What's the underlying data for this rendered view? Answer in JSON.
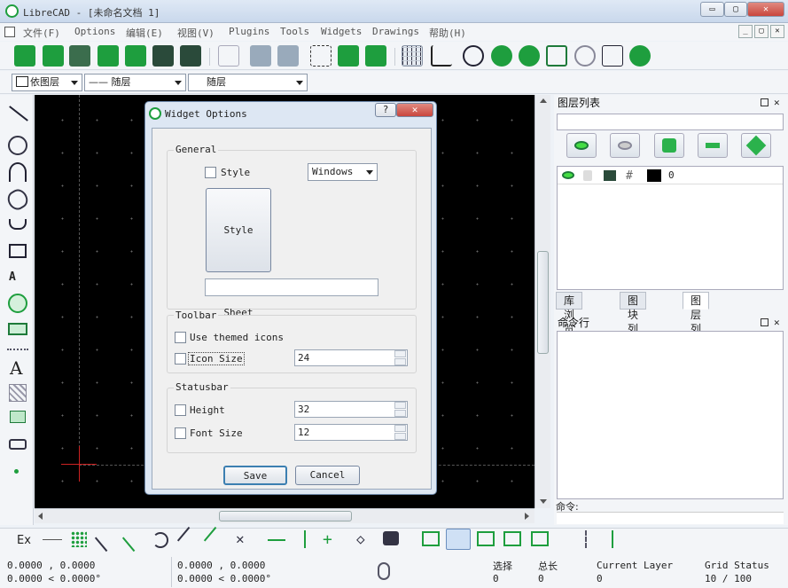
{
  "window": {
    "title": "LibreCAD - [未命名文档 1]",
    "minimize": "▭",
    "maximize": "▢",
    "close": "✕"
  },
  "menu": {
    "items": [
      "文件(F)",
      "Options",
      "编辑(E)",
      "视图(V)",
      "Plugins",
      "Tools",
      "Widgets",
      "Drawings",
      "帮助(H)"
    ],
    "mdi_buttons": [
      "_",
      "▢",
      "✕"
    ]
  },
  "layer_bar": {
    "layer_combo": "依图层",
    "linetype_combo": "—— 随层",
    "width_combo": "随层"
  },
  "dialog": {
    "title": "Widget Options",
    "help_btn": "?",
    "close_btn": "✕",
    "general": {
      "label": "General",
      "style_label": "Style",
      "style_value": "Windows",
      "style_sheet_button": "Style Sheet",
      "style_sheet_path": ""
    },
    "toolbar": {
      "label": "Toolbar",
      "themed_icons_label": "Use themed icons",
      "icon_size_label": "Icon Size",
      "icon_size_value": "24"
    },
    "statusbar": {
      "label": "Statusbar",
      "height_label": "Height",
      "height_value": "32",
      "font_size_label": "Font Size",
      "font_size_value": "12"
    },
    "save": "Save",
    "cancel": "Cancel"
  },
  "right_panel": {
    "layer_list_title": "图层列表",
    "layer_row_name": "0",
    "tabs": [
      "库浏览器",
      "图块列表",
      "图层列表"
    ],
    "cmd_title": "命令行",
    "cmd_prompt": "命令:"
  },
  "statusbar": {
    "coord_abs_1": "0.0000 , 0.0000",
    "coord_abs_2": "0.0000 < 0.0000°",
    "coord_rel_1": "0.0000 , 0.0000",
    "coord_rel_2": "0.0000 < 0.0000°",
    "select_label": "选择",
    "select_value": "0",
    "total_label": "总长",
    "total_value": "0",
    "layer_label": "Current Layer",
    "layer_value": "0",
    "grid_label": "Grid Status",
    "grid_value": "10 / 100"
  },
  "snap_bar": {
    "ex_label": "Ex"
  },
  "colors": {
    "accent_green": "#1e9e3e",
    "canvas": "#000000",
    "close_red": "#c9463d"
  }
}
